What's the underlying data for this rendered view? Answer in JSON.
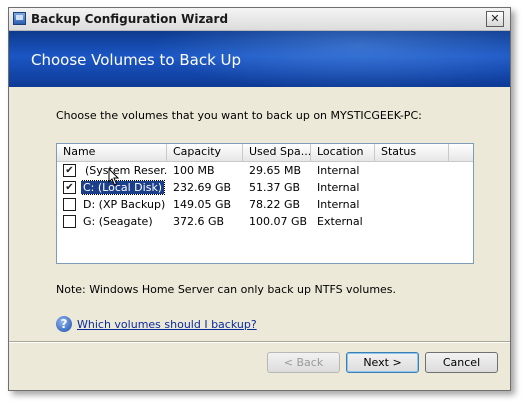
{
  "window": {
    "title": "Backup Configuration Wizard",
    "close_glyph": "✕"
  },
  "banner": {
    "title": "Choose Volumes to Back Up"
  },
  "instruction": "Choose the volumes that you want to back up on MYSTICGEEK-PC:",
  "table": {
    "columns": [
      "Name",
      "Capacity",
      "Used Spa...",
      "Location",
      "Status"
    ],
    "rows": [
      {
        "checked": true,
        "name": "(System Reser...",
        "capacity": "100 MB",
        "used": "29.65 MB",
        "location": "Internal",
        "status": ""
      },
      {
        "checked": true,
        "name": "C: (Local Disk)",
        "capacity": "232.69 GB",
        "used": "51.37 GB",
        "location": "Internal",
        "status": ""
      },
      {
        "checked": false,
        "name": "D: (XP Backup)",
        "capacity": "149.05 GB",
        "used": "78.22 GB",
        "location": "Internal",
        "status": ""
      },
      {
        "checked": false,
        "name": "G: (Seagate)",
        "capacity": "372.6 GB",
        "used": "100.07 GB",
        "location": "External",
        "status": ""
      }
    ]
  },
  "note": "Note: Windows Home Server can only back up NTFS volumes.",
  "help": {
    "icon": "help-icon",
    "link_text": "Which volumes should I backup?"
  },
  "buttons": {
    "back": "< Back",
    "next": "Next >",
    "cancel": "Cancel"
  },
  "check_glyph": "✔"
}
